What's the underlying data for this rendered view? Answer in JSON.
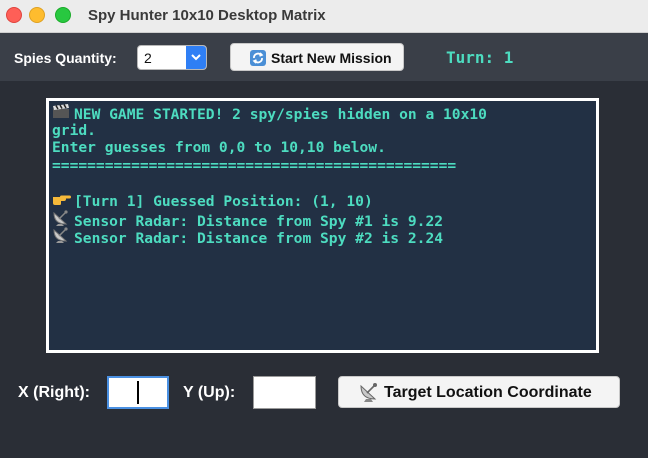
{
  "window": {
    "title": "Spy Hunter 10x10 Desktop Matrix",
    "controls": [
      "close",
      "minimize",
      "zoom"
    ]
  },
  "toolbar": {
    "quantity_label": "Spies Quantity:",
    "quantity_value": "2",
    "start_button_label": "Start New Mission",
    "start_button_icon": "refresh-icon",
    "turn_text": "Turn: 1"
  },
  "log": {
    "lines": [
      {
        "icon": "clapperboard-icon",
        "text": "NEW GAME STARTED! 2 spy/spies hidden on a 10x10"
      },
      {
        "icon": "",
        "text": "grid."
      },
      {
        "icon": "",
        "text": "Enter guesses from 0,0 to 10,10 below."
      },
      {
        "icon": "",
        "text": "=============================================="
      },
      {
        "icon": "",
        "text": ""
      },
      {
        "icon": "pointing-hand-icon",
        "text": "[Turn 1] Guessed Position: (1, 10)"
      },
      {
        "icon": "satellite-dish-icon",
        "text": "Sensor Radar: Distance from Spy #1 is 9.22"
      },
      {
        "icon": "satellite-dish-icon",
        "text": "Sensor Radar: Distance from Spy #2 is 2.24"
      }
    ]
  },
  "inputs": {
    "x_label": "X (Right):",
    "x_value": "",
    "y_label": "Y (Up):",
    "y_value": ""
  },
  "target_button": {
    "label": "Target Location Coordinate",
    "icon": "satellite-dish-icon"
  },
  "colors": {
    "background": "#2a2e36",
    "log_background": "#223044",
    "log_text": "#4ddcc0",
    "accent_blue": "#2f7ff5"
  }
}
